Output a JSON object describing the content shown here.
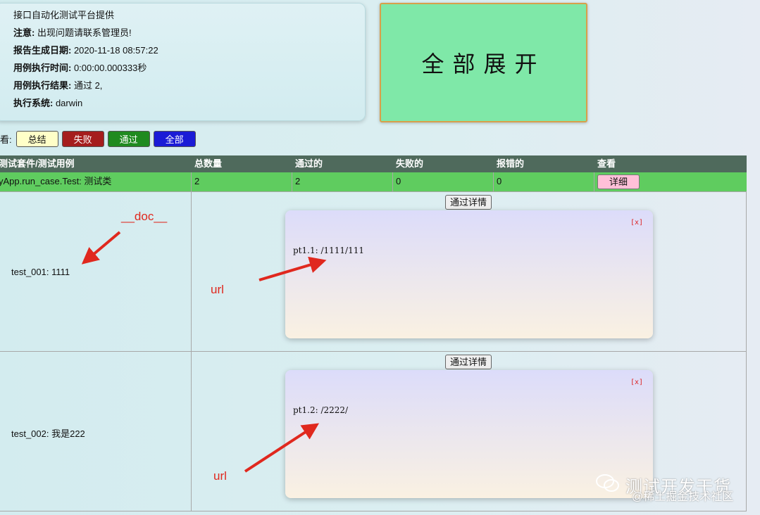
{
  "info": {
    "title": "接口自动化测试平台提供",
    "notice_label": "注意:",
    "notice_value": " 出现问题请联系管理员!",
    "report_date_label": "报告生成日期:",
    "report_date_value": " 2020-11-18 08:57:22",
    "exec_time_label": "用例执行时间:",
    "exec_time_value": " 0:00:00.000333秒",
    "result_label": "用例执行结果:",
    "result_value": " 通过 2,",
    "system_label": "执行系统:",
    "system_value": " darwin"
  },
  "expand_button": "全部展开",
  "filter": {
    "label": "看:",
    "summary": "总结",
    "fail": "失败",
    "pass": "通过",
    "all": "全部"
  },
  "table": {
    "headers": [
      "测试套件/测试用例",
      "总数量",
      "通过的",
      "失败的",
      "报错的",
      "查看"
    ],
    "suite": {
      "name": "yApp.run_case.Test: 测试类",
      "total": "2",
      "passed": "2",
      "failed": "0",
      "errors": "0",
      "detail_button": "详细"
    },
    "cases": [
      {
        "name": "test_001: 1111",
        "pass_button": "通过详情",
        "close": "[x]",
        "output": "pt1.1: /1111/111"
      },
      {
        "name": "test_002: 我是222",
        "pass_button": "通过详情",
        "close": "[x]",
        "output": "pt1.2: /2222/"
      }
    ]
  },
  "annotations": {
    "doc": "__doc__",
    "url1": "url",
    "url2": "url"
  },
  "watermark": {
    "line1": "测试开发干货",
    "line2": "@稀土掘金技术社区"
  },
  "colors": {
    "expand_bg": "#7fe8a8",
    "suite_bg": "#5fcc5f",
    "header_bg": "#4f6a5c",
    "annotation": "#e0281e"
  }
}
